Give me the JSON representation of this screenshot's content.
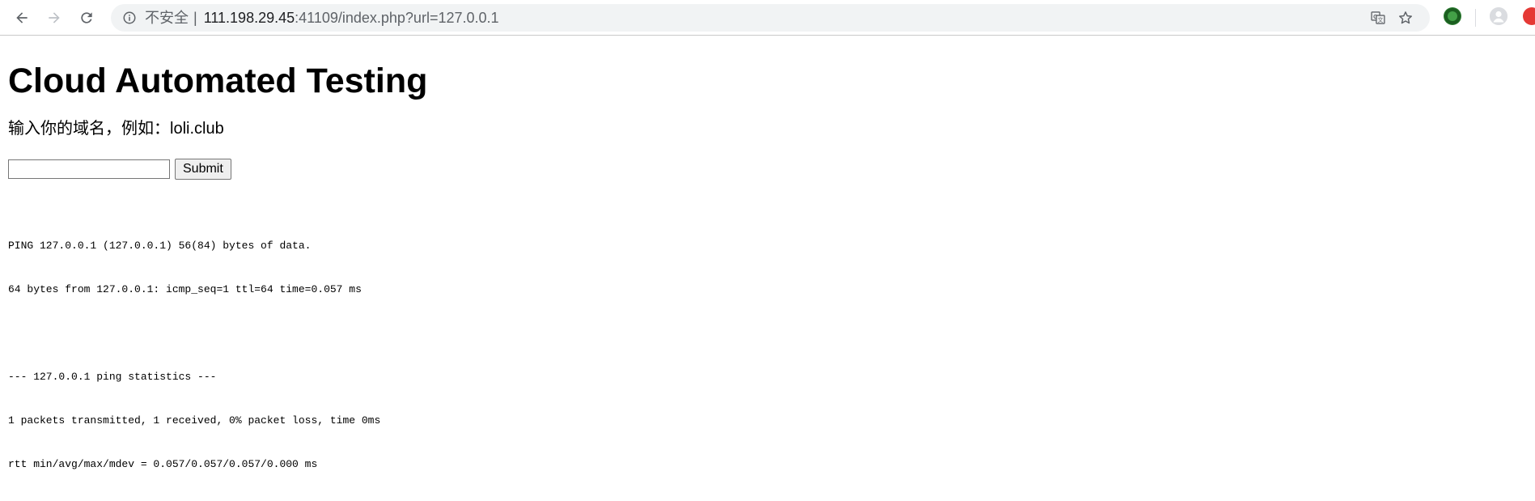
{
  "browser": {
    "security_label": "不安全",
    "url_separator": "|",
    "url_host": "111.198.29.45",
    "url_rest": ":41109/index.php?url=127.0.0.1",
    "icons": {
      "back": "back-arrow-icon",
      "forward": "forward-arrow-icon",
      "reload": "reload-icon",
      "info": "info-icon",
      "translate": "translate-icon",
      "bookmark": "star-icon",
      "extension": "extension-icon",
      "profile": "profile-avatar-icon",
      "extension_2": "red-extension-icon"
    },
    "colors": {
      "extension_green": "#2e7d32",
      "extension_red": "#e53935"
    }
  },
  "page": {
    "title": "Cloud Automated Testing",
    "instruction": "输入你的域名，例如：loli.club",
    "input": {
      "value": "",
      "placeholder": ""
    },
    "submit_label": "Submit",
    "output": {
      "line1": "PING 127.0.0.1 (127.0.0.1) 56(84) bytes of data.",
      "line2": "64 bytes from 127.0.0.1: icmp_seq=1 ttl=64 time=0.057 ms",
      "line3": "--- 127.0.0.1 ping statistics ---",
      "line4": "1 packets transmitted, 1 received, 0% packet loss, time 0ms",
      "line5": "rtt min/avg/max/mdev = 0.057/0.057/0.057/0.000 ms"
    }
  }
}
